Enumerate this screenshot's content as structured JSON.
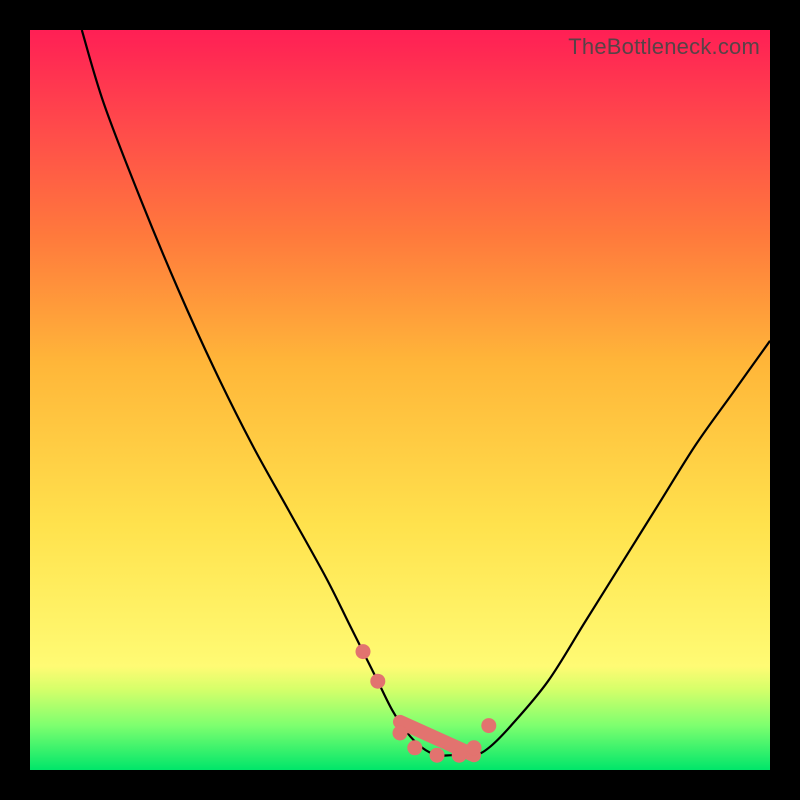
{
  "watermark": "TheBottleneck.com",
  "chart_data": {
    "type": "line",
    "title": "",
    "xlabel": "",
    "ylabel": "",
    "xlim": [
      0,
      100
    ],
    "ylim": [
      0,
      100
    ],
    "x": [
      7,
      10,
      15,
      20,
      25,
      30,
      35,
      40,
      43,
      45,
      47,
      49,
      51,
      53,
      55,
      57,
      60,
      62,
      65,
      70,
      75,
      80,
      85,
      90,
      95,
      100
    ],
    "values": [
      100,
      90,
      77,
      65,
      54,
      44,
      35,
      26,
      20,
      16,
      12,
      8,
      5,
      3,
      2,
      2,
      2,
      3,
      6,
      12,
      20,
      28,
      36,
      44,
      51,
      58
    ],
    "markers": {
      "x": [
        45,
        47,
        50,
        52,
        55,
        58,
        60,
        62
      ],
      "y": [
        16,
        12,
        5,
        3,
        2,
        2,
        3,
        6
      ]
    },
    "colors": {
      "curve": "#000000",
      "marker": "#e2736f",
      "gradient_top": "#ff1f55",
      "gradient_bottom": "#00e66a"
    }
  }
}
